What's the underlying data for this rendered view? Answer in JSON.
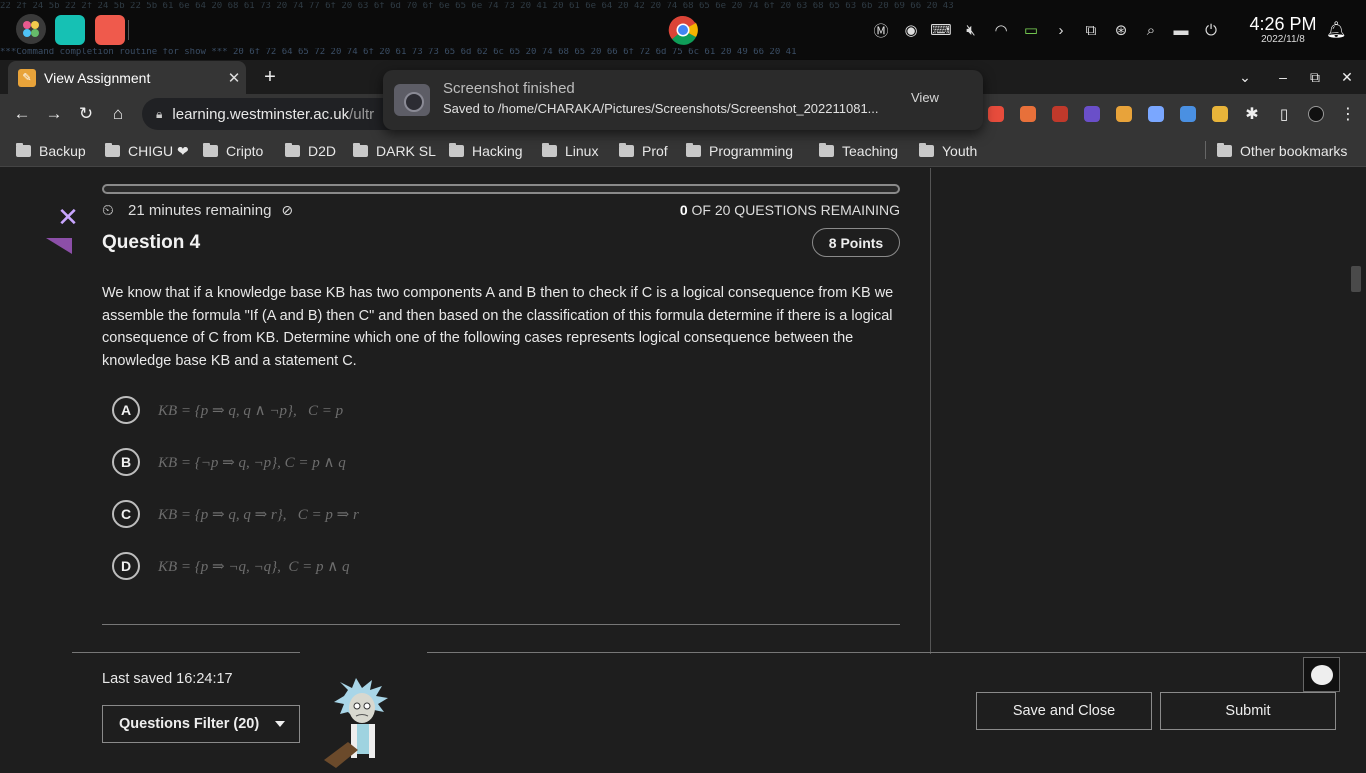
{
  "os_panel": {
    "hex_line_1": "22 2f 24 5b 22 2f 24 5b 22 5b 61 6e 64 20 68 61 73 20 74 77 6f 20 63 6f 6d 70 6f 6e 65 6e 74 73 20 41 20 61 6e 64 20 42 20 74 68 65 6e 20 74 6f 20 63 68 65 63 6b 20 69 66 20 43",
    "hex_line_2": "***Command completion routine for show ***  20 6f 72 64 65 72 20 74 6f 20 61 73 73 65 6d 62 6c 65 20 74 68 65 20 66 6f 72 6d 75 6c 61 20 49 66 20 41",
    "clock_time": "4:26 PM",
    "clock_date": "2022/11/8"
  },
  "browser": {
    "tab_title": "View Assignment",
    "url_host": "learning.westminster.ac.uk",
    "url_rest": "/ultr",
    "bookmarks": [
      "Backup",
      "CHIGU ❤",
      "Cripto",
      "D2D",
      "DARK SL",
      "Hacking",
      "Linux",
      "Prof",
      "Programming",
      "Teaching",
      "Youth"
    ],
    "other_bookmarks": "Other bookmarks",
    "ext_colors": [
      "#e74c3c",
      "#e8703a",
      "#c0392b",
      "#6a4fc9",
      "#e8a33a",
      "#7aa7ff",
      "#4a90e2",
      "#e8b43a"
    ]
  },
  "toast": {
    "title": "Screenshot finished",
    "body": "Saved to /home/CHARAKA/Pictures/Screenshots/Screenshot_202211081...",
    "action": "View"
  },
  "assignment": {
    "timer": "21 minutes remaining",
    "remaining_count": "0",
    "remaining_text": "OF 20 QUESTIONS REMAINING",
    "question_title": "Question 4",
    "points": "8 Points",
    "question_text": "We know that if a knowledge base KB has two components A and B then to check if C is a logical consequence from KB we assemble the formula \"If (A and B) then C\" and then based on the classification of this formula determine if there is a logical consequence of C from KB. Determine which one of the following cases represents logical consequence between the knowledge base KB and a statement C.",
    "options": [
      {
        "letter": "A",
        "expr": "KB = {p ⇒ q, q ∧ ¬p},   C = p"
      },
      {
        "letter": "B",
        "expr": "KB = {¬p ⇒ q, ¬p}, C = p ∧ q"
      },
      {
        "letter": "C",
        "expr": "KB = {p ⇒ q, q ⇒ r},   C = p ⇒ r"
      },
      {
        "letter": "D",
        "expr": "KB = {p ⇒ ¬q, ¬q},  C = p ∧ q"
      }
    ],
    "last_saved": "Last saved 16:24:17",
    "filter_label": "Questions Filter (20)",
    "save_close": "Save and Close",
    "submit": "Submit"
  }
}
